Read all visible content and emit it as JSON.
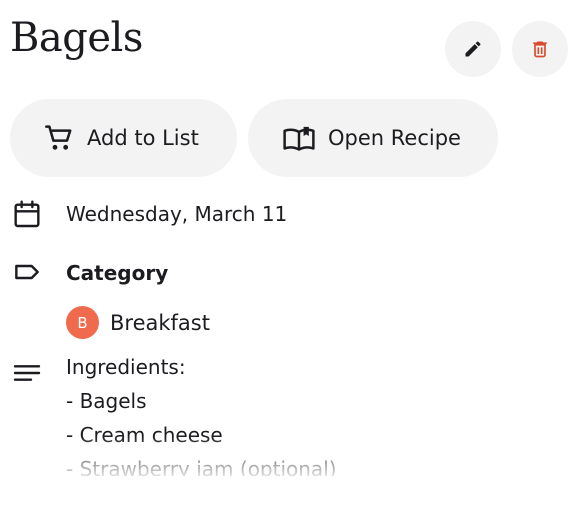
{
  "header": {
    "title": "Bagels"
  },
  "toolbar": {
    "edit_icon": "pencil-icon",
    "delete_icon": "trash-icon",
    "delete_color": "#d84b2c"
  },
  "actions": {
    "add_to_list": {
      "label": "Add to List",
      "icon": "cart-icon"
    },
    "open_recipe": {
      "label": "Open Recipe",
      "icon": "open-book-icon"
    }
  },
  "details": {
    "date": {
      "icon": "calendar-icon",
      "text": "Wednesday, March 11"
    },
    "category": {
      "icon": "label-tag-icon",
      "heading": "Category",
      "chip": {
        "initial": "B",
        "label": "Breakfast",
        "color": "#f06a4e"
      }
    },
    "notes": {
      "icon": "notes-lines-icon",
      "lines": [
        "Ingredients:",
        "- Bagels",
        "- Cream cheese",
        "- Strawberry jam (optional)"
      ]
    }
  }
}
